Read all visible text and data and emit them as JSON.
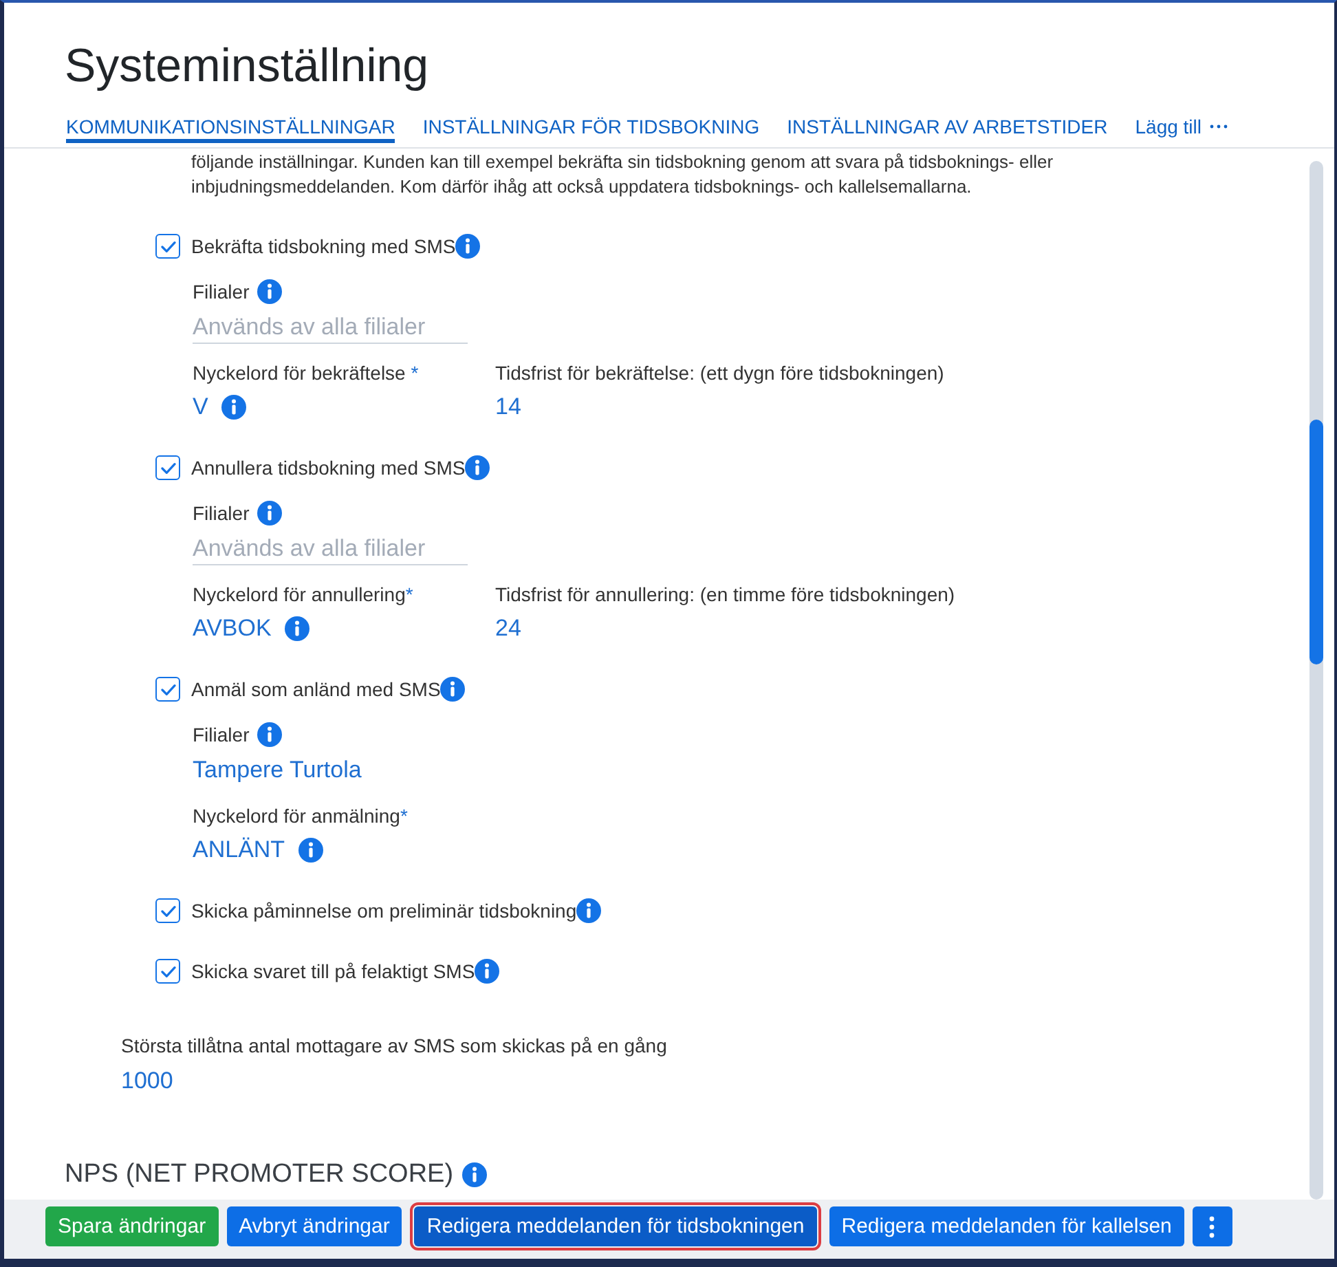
{
  "page": {
    "title": "Systeminställning"
  },
  "tabs": [
    {
      "label": "KOMMUNIKATIONSINSTÄLLNINGAR",
      "selected": true
    },
    {
      "label": "INSTÄLLNINGAR FÖR TIDSBOKNING",
      "selected": false
    },
    {
      "label": "INSTÄLLNINGAR AV ARBETSTIDER",
      "selected": false
    }
  ],
  "tabs_overflow": {
    "label": "Lägg till"
  },
  "intro_lines": [
    "följande inställningar. Kunden kan till exempel bekräfta sin tidsbokning genom att svara på tidsboknings- eller",
    "inbjudningsmeddelanden. Kom därför ihåg att också uppdatera tidsboknings- och kallelsemallarna."
  ],
  "options": [
    {
      "label": "Bekräfta tidsbokning med SMS",
      "checked": true,
      "branches": {
        "label": "Filialer",
        "placeholder": "Används av alla filialer"
      },
      "fields": [
        {
          "label": "Nyckelord för bekräftelse",
          "required_mark": " *",
          "value": "V",
          "info": true
        },
        {
          "label": "Tidsfrist för bekräftelse: (ett dygn före tidsbokningen)",
          "value": "14",
          "info": false
        }
      ]
    },
    {
      "label": "Annullera tidsbokning med SMS",
      "checked": true,
      "branches": {
        "label": "Filialer",
        "placeholder": "Används av alla filialer"
      },
      "fields": [
        {
          "label": "Nyckelord för annullering",
          "required_mark": "*",
          "value": "AVBOK",
          "info": true
        },
        {
          "label": "Tidsfrist för annullering: (en timme före tidsbokningen)",
          "value": "24",
          "info": false
        }
      ]
    },
    {
      "label": "Anmäl som anländ med SMS",
      "checked": true,
      "branches": {
        "label": "Filialer",
        "value": "Tampere Turtola"
      },
      "fields": [
        {
          "label": "Nyckelord för anmälning",
          "required_mark": "*",
          "value": "ANLÄNT",
          "info": true
        }
      ]
    },
    {
      "label": "Skicka påminnelse om preliminär tidsbokning",
      "checked": true
    },
    {
      "label": "Skicka svaret till på felaktigt SMS",
      "checked": true
    }
  ],
  "max_recipients": {
    "label": "Största tillåtna antal mottagare av SMS som skickas på en gång",
    "value": "1000"
  },
  "next_section": {
    "title": "NPS (NET PROMOTER SCORE)"
  },
  "footer": {
    "buttons": [
      {
        "label": "Spara ändringar",
        "kind": "success",
        "highlighted": false
      },
      {
        "label": "Avbryt ändringar",
        "kind": "primary",
        "highlighted": false
      },
      {
        "label": "Redigera meddelanden för tidsbokningen",
        "kind": "primary",
        "highlighted": true
      },
      {
        "label": "Redigera meddelanden för kallelsen",
        "kind": "primary",
        "highlighted": false
      }
    ]
  }
}
